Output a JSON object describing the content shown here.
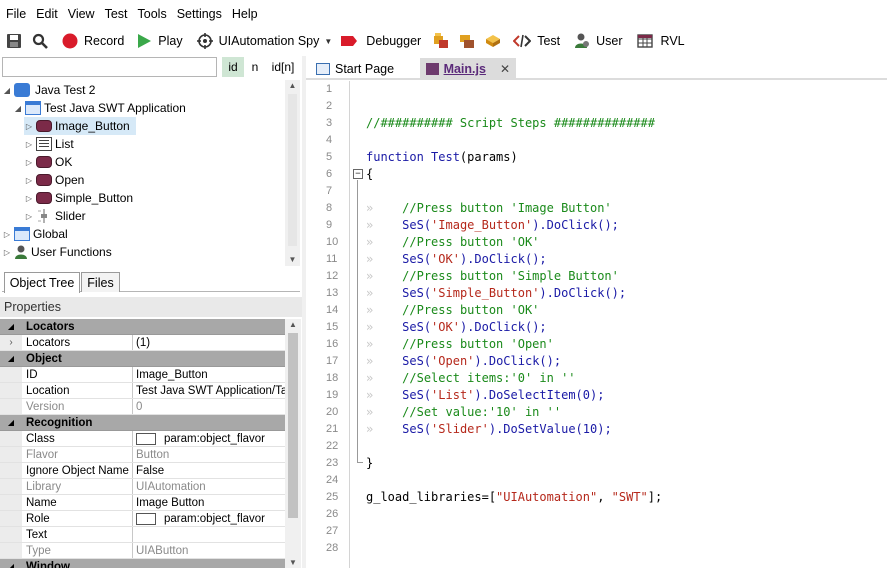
{
  "menu": [
    "File",
    "Edit",
    "View",
    "Test",
    "Tools",
    "Settings",
    "Help"
  ],
  "toolbar": {
    "record": "Record",
    "play": "Play",
    "uiautomation_spy": "UIAutomation Spy",
    "debugger": "Debugger",
    "test": "Test",
    "user": "User",
    "rvl": "RVL"
  },
  "search": {
    "value": "",
    "btn_id": "id",
    "btn_n": "n",
    "btn_idn": "id[n]"
  },
  "tree": [
    {
      "label": "Java Test 2"
    },
    {
      "label": "Test Java SWT Application"
    },
    {
      "label": "Image_Button"
    },
    {
      "label": "List"
    },
    {
      "label": "OK"
    },
    {
      "label": "Open"
    },
    {
      "label": "Simple_Button"
    },
    {
      "label": "Slider"
    },
    {
      "label": "Global"
    },
    {
      "label": "User Functions"
    }
  ],
  "left_tabs": {
    "object_tree": "Object Tree",
    "files": "Files"
  },
  "properties": {
    "title": "Properties",
    "rows": [
      {
        "k": "Locators",
        "v": "",
        "cat": true
      },
      {
        "k": "Locators",
        "v": "(1)"
      },
      {
        "k": "Object",
        "v": "",
        "cat": true
      },
      {
        "k": "ID",
        "v": "Image_Button"
      },
      {
        "k": "Location",
        "v": "Test Java SWT Application/Ta"
      },
      {
        "k": "Version",
        "v": "0"
      },
      {
        "k": "Recognition",
        "v": "",
        "cat": true
      },
      {
        "k": "Class",
        "v": "param:object_flavor"
      },
      {
        "k": "Flavor",
        "v": "Button"
      },
      {
        "k": "Ignore Object Name",
        "v": "False"
      },
      {
        "k": "Library",
        "v": "UIAutomation"
      },
      {
        "k": "Name",
        "v": "Image Button"
      },
      {
        "k": "Role",
        "v": "param:object_flavor"
      },
      {
        "k": "Text",
        "v": ""
      },
      {
        "k": "Type",
        "v": "UIAButton"
      },
      {
        "k": "Window",
        "v": "",
        "cat": true
      }
    ]
  },
  "editor_tabs": {
    "start": "Start Page",
    "main": "Main.js",
    "close": "✕"
  },
  "code": {
    "line_numbers": [
      "1",
      "2",
      "3",
      "4",
      "5",
      "6",
      "7",
      "8",
      "9",
      "10",
      "11",
      "12",
      "13",
      "14",
      "15",
      "16",
      "17",
      "18",
      "19",
      "20",
      "21",
      "22",
      "23",
      "24",
      "25",
      "26",
      "27",
      "28"
    ],
    "l3": "//########## Script Steps ##############",
    "l5_kw": "function",
    "l5_fn": " Test",
    "l5_rest": "(params)",
    "l6": "{",
    "arrow": "»",
    "l8": "//Press button 'Image Button'",
    "l9_a": "SeS(",
    "l9_s": "'Image_Button'",
    "l9_b": ").DoClick();",
    "l10": "//Press button 'OK'",
    "l11_a": "SeS(",
    "l11_s": "'OK'",
    "l11_b": ").DoClick();",
    "l12": "//Press button 'Simple Button'",
    "l13_a": "SeS(",
    "l13_s": "'Simple_Button'",
    "l13_b": ").DoClick();",
    "l14": "//Press button 'OK'",
    "l15_a": "SeS(",
    "l15_s": "'OK'",
    "l15_b": ").DoClick();",
    "l16": "//Press button 'Open'",
    "l17_a": "SeS(",
    "l17_s": "'Open'",
    "l17_b": ").DoClick();",
    "l18": "//Select items:'0' in ''",
    "l19_a": "SeS(",
    "l19_s": "'List'",
    "l19_b": ").DoSelectItem(",
    "l19_n": "0",
    "l19_c": ");",
    "l20": "//Set value:'10' in ''",
    "l21_a": "SeS(",
    "l21_s": "'Slider'",
    "l21_b": ").DoSetValue(",
    "l21_n": "10",
    "l21_c": ");",
    "l23": "}",
    "l25_a": "g_load_libraries=[",
    "l25_s1": "\"UIAutomation\"",
    "l25_m": ", ",
    "l25_s2": "\"SWT\"",
    "l25_b": "];"
  },
  "colors": {
    "accent": "#2f62b5",
    "selection": "#d6e9f7",
    "comment": "#1a8a1a",
    "keyword": "#1a1aa6",
    "string": "#b5281b"
  }
}
